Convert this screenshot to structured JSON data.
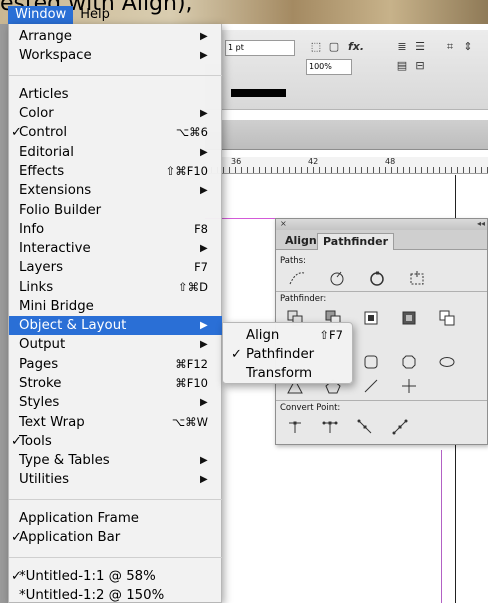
{
  "background_title": "ested with Align),",
  "menubar": {
    "window_label": "Window",
    "help_label": "Help"
  },
  "toolbar": {
    "stroke_weight": "1 pt",
    "zoom_percent": "100%",
    "fx_label": "fx."
  },
  "ruler": {
    "ticks": [
      "36",
      "42",
      "48"
    ]
  },
  "window_menu": {
    "items": [
      {
        "label": "Arrange",
        "submenu": true
      },
      {
        "label": "Workspace",
        "submenu": true
      },
      {
        "separator": true
      },
      {
        "label": "Articles"
      },
      {
        "label": "Color",
        "submenu": true
      },
      {
        "label": "Control",
        "checked": true,
        "shortcut": "⌥⌘6"
      },
      {
        "label": "Editorial",
        "submenu": true
      },
      {
        "label": "Effects",
        "shortcut": "⇧⌘F10"
      },
      {
        "label": "Extensions",
        "submenu": true
      },
      {
        "label": "Folio Builder"
      },
      {
        "label": "Info",
        "shortcut": "F8"
      },
      {
        "label": "Interactive",
        "submenu": true
      },
      {
        "label": "Layers",
        "shortcut": "F7"
      },
      {
        "label": "Links",
        "shortcut": "⇧⌘D"
      },
      {
        "label": "Mini Bridge"
      },
      {
        "label": "Object & Layout",
        "submenu": true,
        "highlighted": true
      },
      {
        "label": "Output",
        "submenu": true
      },
      {
        "label": "Pages",
        "shortcut": "⌘F12"
      },
      {
        "label": "Stroke",
        "shortcut": "⌘F10"
      },
      {
        "label": "Styles",
        "submenu": true
      },
      {
        "label": "Text Wrap",
        "shortcut": "⌥⌘W"
      },
      {
        "label": "Tools",
        "checked": true
      },
      {
        "label": "Type & Tables",
        "submenu": true
      },
      {
        "label": "Utilities",
        "submenu": true
      },
      {
        "separator": true
      },
      {
        "label": "Application Frame"
      },
      {
        "label": "Application Bar",
        "checked": true
      },
      {
        "separator": true
      },
      {
        "label": "*Untitled-1:1 @ 58%",
        "checked": true
      },
      {
        "label": "*Untitled-1:2 @ 150%"
      }
    ]
  },
  "submenu": {
    "items": [
      {
        "label": "Align",
        "shortcut": "⇧F7"
      },
      {
        "label": "Pathfinder",
        "checked": true
      },
      {
        "label": "Transform"
      }
    ]
  },
  "panel": {
    "close_glyph": "×",
    "collapse_glyph": "◂◂",
    "tabs": [
      "Align",
      "Pathfinder"
    ],
    "paths_label": "Paths:",
    "pathfinder_label": "Pathfinder:",
    "convert_label": "Convert Point:"
  },
  "colors": {
    "highlight": "#2a6fd6",
    "menu_bg": "#f2f2f2",
    "panel_bg": "#e8e8e8",
    "guide_magenta": "#d35ad8"
  }
}
